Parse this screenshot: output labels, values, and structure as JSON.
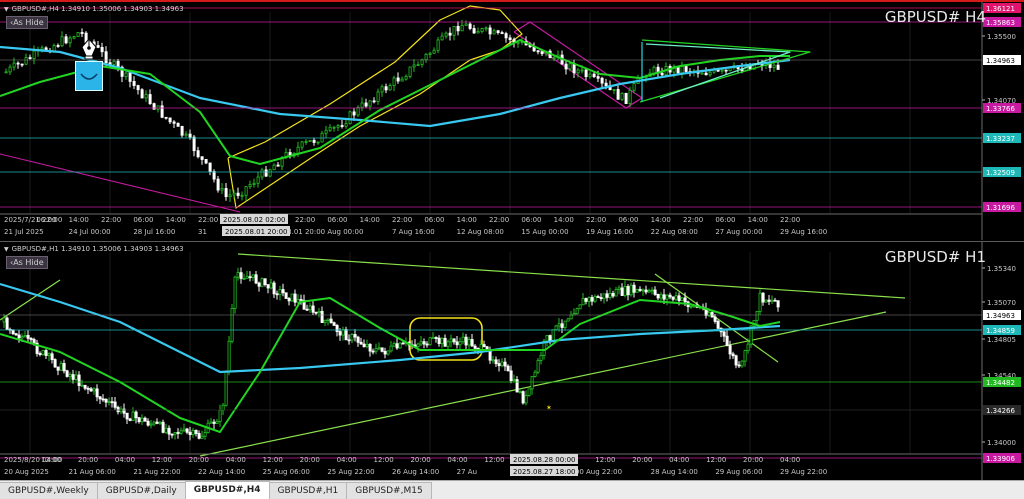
{
  "top_chart": {
    "info": "GBPUSD#,H4  1.34910 1.35006 1.34903 1.34963",
    "title": "GBPUSD# H4",
    "hide_label": "‹As Hide",
    "price_levels": [
      {
        "value": "1.36121",
        "color": "#e0146c",
        "highlight": true
      },
      {
        "value": "1.35863",
        "color": "#c71aa0",
        "highlight": true
      },
      {
        "value": "1.35500",
        "color": "#cccccc",
        "highlight": false
      },
      {
        "value": "1.34963",
        "color": "#ffffff",
        "highlight": false
      },
      {
        "value": "1.34070",
        "color": "#cccccc",
        "highlight": false
      },
      {
        "value": "1.33766",
        "color": "#c71aa0",
        "highlight": true
      },
      {
        "value": "1.33237",
        "color": "#1fb8b8",
        "highlight": true
      },
      {
        "value": "1.32509",
        "color": "#1fb8b8",
        "highlight": true
      },
      {
        "value": "1.31696",
        "color": "#c71aa0",
        "highlight": true
      }
    ],
    "time_labels": [
      "2025/7/21 22:00",
      "06:00",
      "14:00",
      "22:00",
      "06:00",
      "14:00",
      "22:00",
      "06:00",
      "14:00",
      "22:00",
      "06:00",
      "14:00",
      "22:00",
      "06:00",
      "14:00",
      "22:00",
      "06:00",
      "14:00",
      "22:00",
      "06:00",
      "14:00",
      "22:00",
      "06:00",
      "14:00",
      "22:00"
    ],
    "date_labels": [
      "21 Jul 2025",
      "24 Jul 00:00",
      "28 Jul 16:00",
      "31",
      "2025.08.01 20:00",
      "Aug 00:00",
      "7 Aug 16:00",
      "12 Aug 08:00",
      "15 Aug 00:00",
      "19 Aug 16:00",
      "22 Aug 08:00",
      "27 Aug 00:00",
      "29 Aug 16:00"
    ],
    "crosshair_label": "2025.08.02 02:00",
    "crosshair_date_label": "2025.08.01 20:00"
  },
  "bottom_chart": {
    "info": "GBPUSD#,H1  1.34910 1.35006 1.34903 1.34963",
    "title": "GBPUSD# H1",
    "hide_label": "‹As Hide",
    "price_levels": [
      {
        "value": "1.35340",
        "color": "#cccccc",
        "highlight": false
      },
      {
        "value": "1.35070",
        "color": "#cccccc",
        "highlight": false
      },
      {
        "value": "1.34963",
        "color": "#ffffff",
        "highlight": false
      },
      {
        "value": "1.34859",
        "color": "#1fb8b8",
        "highlight": true
      },
      {
        "value": "1.34805",
        "color": "#cccccc",
        "highlight": false
      },
      {
        "value": "1.34540",
        "color": "#cccccc",
        "highlight": false
      },
      {
        "value": "1.34482",
        "color": "#22b822",
        "highlight": true
      },
      {
        "value": "1.34266",
        "color": "#2a2a2a",
        "highlight": true
      },
      {
        "value": "1.34000",
        "color": "#cccccc",
        "highlight": false
      },
      {
        "value": "1.33906",
        "color": "#c71aa0",
        "highlight": true
      }
    ],
    "time_labels": [
      "2025/8/20 04:00",
      "12:00",
      "20:00",
      "04:00",
      "12:00",
      "20:00",
      "04:00",
      "12:00",
      "20:00",
      "04:00",
      "12:00",
      "20:00",
      "04:00",
      "12:00",
      "20:00",
      "04:00",
      "12:00",
      "20:00",
      "04:00",
      "12:00",
      "20:00",
      "04:00"
    ],
    "date_labels": [
      "20 Aug 2025",
      "21 Aug 06:00",
      "21 Aug 22:00",
      "22 Aug 14:00",
      "25 Aug 06:00",
      "25 Aug 22:00",
      "26 Aug 14:00",
      "27 Au",
      "2025.08.27 18:00",
      "Aug 22:00",
      "28 Aug 14:00",
      "29 Aug 06:00",
      "29 Aug 22:00"
    ],
    "crosshair_label": "2025.08.28 00:00",
    "crosshair_date_label": "2025.08.27 18:00"
  },
  "tabs": [
    "GBPUSD#,Weekly",
    "GBPUSD#,Daily",
    "GBPUSD#,H4",
    "GBPUSD#,H1",
    "GBPUSD#,M15"
  ],
  "active_tab": "GBPUSD#,H4",
  "colors": {
    "background": "#000000",
    "candle": "#ffffff",
    "bull_candle": "#22c022",
    "ma_fast": "#22d422",
    "ma_slow": "#38c8f0",
    "channel_yellow": "#f2e21a",
    "magenta_line": "#c71aa0",
    "trend_green": "#8ae04a"
  },
  "icons": [
    "pen-icon",
    "smile-icon"
  ]
}
